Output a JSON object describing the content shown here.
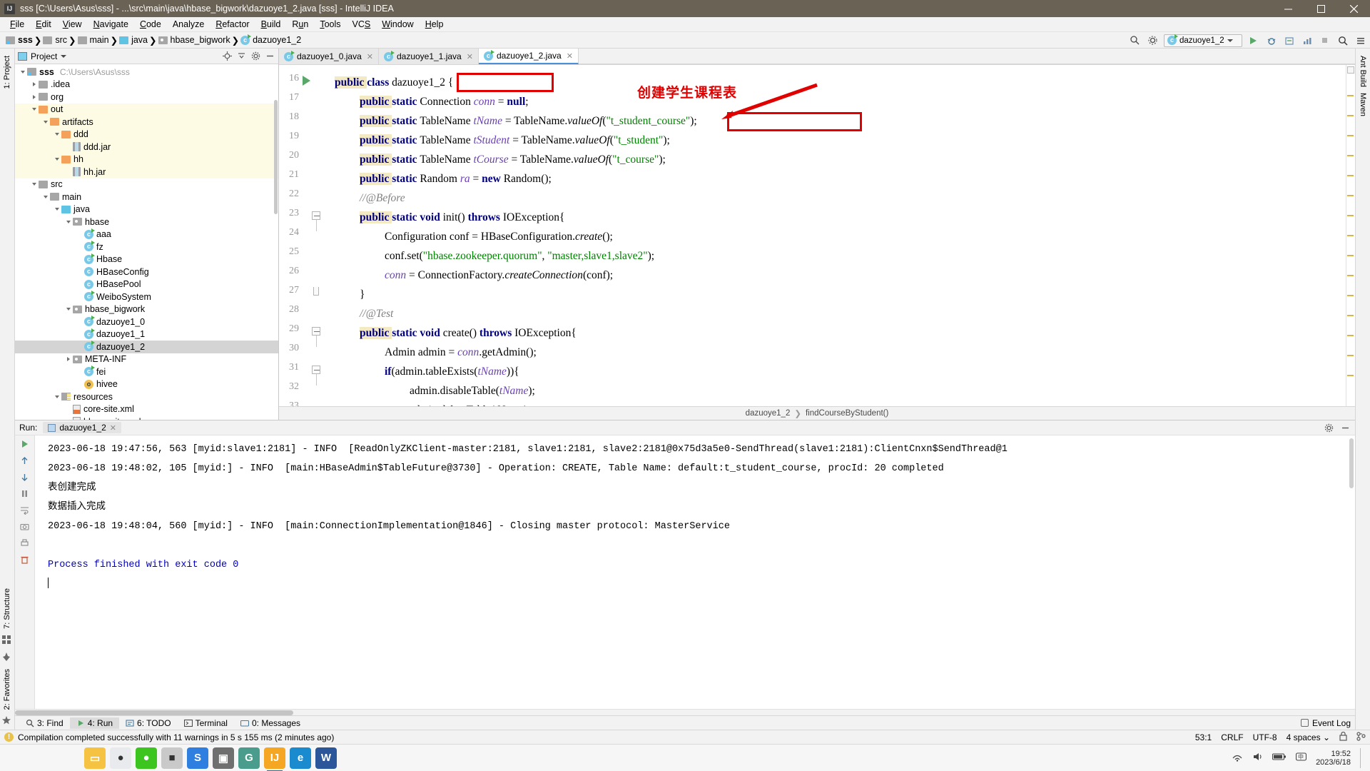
{
  "window": {
    "title": "sss [C:\\Users\\Asus\\sss] - ...\\src\\main\\java\\hbase_bigwork\\dazuoye1_2.java [sss] - IntelliJ IDEA",
    "app_icon": "IJ",
    "minimize": "minimize-icon",
    "maximize": "maximize-icon",
    "close": "close-icon"
  },
  "menu": [
    "File",
    "Edit",
    "View",
    "Navigate",
    "Code",
    "Analyze",
    "Refactor",
    "Build",
    "Run",
    "Tools",
    "VCS",
    "Window",
    "Help"
  ],
  "breadcrumb": [
    {
      "label": "sss",
      "icon": "module-folder-icon"
    },
    {
      "label": "src",
      "icon": "source-folder-icon"
    },
    {
      "label": "main",
      "icon": "folder-icon"
    },
    {
      "label": "java",
      "icon": "java-source-folder-icon"
    },
    {
      "label": "hbase_bigwork",
      "icon": "package-icon"
    },
    {
      "label": "dazuoye1_2",
      "icon": "java-class-icon"
    }
  ],
  "toolbar": {
    "run_config": "dazuoye1_2",
    "run_label": "run-button",
    "debug_label": "debug-button",
    "coverage_label": "coverage-button",
    "profile_label": "profile-button",
    "search_label": "search-button",
    "stop_label": "stop-button"
  },
  "left_strip": [
    "1: Project",
    "7: Structure",
    "2: Favorites"
  ],
  "right_strip": [
    "Ant Build",
    "Maven"
  ],
  "project_panel": {
    "title": "Project",
    "locate_icon": "locate-icon",
    "collapse_icon": "collapse-all-icon",
    "settings_icon": "gear-icon",
    "hide_icon": "hide-icon",
    "tree": [
      {
        "label": "sss",
        "path": "C:\\Users\\Asus\\sss",
        "depth": 0,
        "arrow": "open",
        "icon": "module-folder",
        "bold": true,
        "state": "normal"
      },
      {
        "label": ".idea",
        "depth": 1,
        "arrow": "closed",
        "icon": "folder",
        "state": "normal"
      },
      {
        "label": "org",
        "depth": 1,
        "arrow": "closed",
        "icon": "folder",
        "state": "normal"
      },
      {
        "label": "out",
        "depth": 1,
        "arrow": "open",
        "icon": "folder-orange",
        "state": "highlight"
      },
      {
        "label": "artifacts",
        "depth": 2,
        "arrow": "open",
        "icon": "folder-orange",
        "state": "highlight"
      },
      {
        "label": "ddd",
        "depth": 3,
        "arrow": "open",
        "icon": "folder-orange",
        "state": "highlight"
      },
      {
        "label": "ddd.jar",
        "depth": 4,
        "arrow": "none",
        "icon": "jar",
        "state": "highlight"
      },
      {
        "label": "hh",
        "depth": 3,
        "arrow": "open",
        "icon": "folder-orange",
        "state": "highlight"
      },
      {
        "label": "hh.jar",
        "depth": 4,
        "arrow": "none",
        "icon": "jar",
        "state": "highlight"
      },
      {
        "label": "src",
        "depth": 1,
        "arrow": "open",
        "icon": "folder",
        "state": "normal"
      },
      {
        "label": "main",
        "depth": 2,
        "arrow": "open",
        "icon": "folder",
        "state": "normal"
      },
      {
        "label": "java",
        "depth": 3,
        "arrow": "open",
        "icon": "folder-cyan",
        "state": "normal"
      },
      {
        "label": "hbase",
        "depth": 4,
        "arrow": "open",
        "icon": "package",
        "state": "normal"
      },
      {
        "label": "aaa",
        "depth": 5,
        "arrow": "none",
        "icon": "java-class-run",
        "state": "normal"
      },
      {
        "label": "fz",
        "depth": 5,
        "arrow": "none",
        "icon": "java-class-run",
        "state": "normal"
      },
      {
        "label": "Hbase",
        "depth": 5,
        "arrow": "none",
        "icon": "java-class-run",
        "state": "normal"
      },
      {
        "label": "HBaseConfig",
        "depth": 5,
        "arrow": "none",
        "icon": "java-class",
        "state": "normal"
      },
      {
        "label": "HBasePool",
        "depth": 5,
        "arrow": "none",
        "icon": "java-class",
        "state": "normal"
      },
      {
        "label": "WeiboSystem",
        "depth": 5,
        "arrow": "none",
        "icon": "java-class-run",
        "state": "normal"
      },
      {
        "label": "hbase_bigwork",
        "depth": 4,
        "arrow": "open",
        "icon": "package",
        "state": "normal"
      },
      {
        "label": "dazuoye1_0",
        "depth": 5,
        "arrow": "none",
        "icon": "java-class-run",
        "state": "normal"
      },
      {
        "label": "dazuoye1_1",
        "depth": 5,
        "arrow": "none",
        "icon": "java-class-run",
        "state": "normal"
      },
      {
        "label": "dazuoye1_2",
        "depth": 5,
        "arrow": "none",
        "icon": "java-class-run",
        "state": "selected"
      },
      {
        "label": "META-INF",
        "depth": 4,
        "arrow": "closed",
        "icon": "package",
        "state": "normal"
      },
      {
        "label": "fei",
        "depth": 5,
        "arrow": "none",
        "icon": "java-class-run",
        "state": "normal"
      },
      {
        "label": "hivee",
        "depth": 5,
        "arrow": "none",
        "icon": "object-class",
        "state": "normal"
      },
      {
        "label": "resources",
        "depth": 3,
        "arrow": "open",
        "icon": "resources-folder",
        "state": "normal"
      },
      {
        "label": "core-site.xml",
        "depth": 4,
        "arrow": "none",
        "icon": "xml-file",
        "state": "normal"
      },
      {
        "label": "hbase-site.xml",
        "depth": 4,
        "arrow": "none",
        "icon": "xml-file",
        "state": "normal"
      }
    ]
  },
  "editor": {
    "tabs": [
      {
        "label": "dazuoye1_0.java",
        "active": false
      },
      {
        "label": "dazuoye1_1.java",
        "active": false
      },
      {
        "label": "dazuoye1_2.java",
        "active": true
      }
    ],
    "first_line_number": 16,
    "lines": [
      {
        "n": 16,
        "runmark": true,
        "fold": "none",
        "indent": 0,
        "tokens": [
          {
            "t": "public ",
            "c": "kw hl-pub"
          },
          {
            "t": "class ",
            "c": "kw"
          },
          {
            "t": "dazuoye1_2 {",
            "c": "id"
          }
        ]
      },
      {
        "n": 17,
        "runmark": false,
        "fold": "none",
        "indent": 1,
        "tokens": [
          {
            "t": "public ",
            "c": "kw hl-pub"
          },
          {
            "t": "static ",
            "c": "kw"
          },
          {
            "t": "Connection ",
            "c": "id"
          },
          {
            "t": "conn",
            "c": "fieldv"
          },
          {
            "t": " = ",
            "c": "id"
          },
          {
            "t": "null",
            "c": "kw"
          },
          {
            "t": ";",
            "c": "id"
          }
        ]
      },
      {
        "n": 18,
        "runmark": false,
        "fold": "none",
        "indent": 1,
        "tokens": [
          {
            "t": "public ",
            "c": "kw hl-pub"
          },
          {
            "t": "static ",
            "c": "kw"
          },
          {
            "t": "TableName ",
            "c": "id"
          },
          {
            "t": "tName",
            "c": "fieldv"
          },
          {
            "t": " = TableName.",
            "c": "id"
          },
          {
            "t": "valueOf",
            "c": "mth"
          },
          {
            "t": "(",
            "c": "id"
          },
          {
            "t": "\"t_student_course\"",
            "c": "str"
          },
          {
            "t": ");",
            "c": "id"
          }
        ]
      },
      {
        "n": 19,
        "runmark": false,
        "fold": "none",
        "indent": 1,
        "tokens": [
          {
            "t": "public ",
            "c": "kw hl-pub"
          },
          {
            "t": "static ",
            "c": "kw"
          },
          {
            "t": "TableName ",
            "c": "id"
          },
          {
            "t": "tStudent",
            "c": "fieldv"
          },
          {
            "t": " = TableName.",
            "c": "id"
          },
          {
            "t": "valueOf",
            "c": "mth"
          },
          {
            "t": "(",
            "c": "id"
          },
          {
            "t": "\"t_student\"",
            "c": "str"
          },
          {
            "t": ");",
            "c": "id"
          }
        ]
      },
      {
        "n": 20,
        "runmark": false,
        "fold": "none",
        "indent": 1,
        "tokens": [
          {
            "t": "public ",
            "c": "kw hl-pub"
          },
          {
            "t": "static ",
            "c": "kw"
          },
          {
            "t": "TableName ",
            "c": "id"
          },
          {
            "t": "tCourse",
            "c": "fieldv"
          },
          {
            "t": " = TableName.",
            "c": "id"
          },
          {
            "t": "valueOf",
            "c": "mth"
          },
          {
            "t": "(",
            "c": "id"
          },
          {
            "t": "\"t_course\"",
            "c": "str"
          },
          {
            "t": ");",
            "c": "id"
          }
        ]
      },
      {
        "n": 21,
        "runmark": false,
        "fold": "none",
        "indent": 1,
        "tokens": [
          {
            "t": "public ",
            "c": "kw hl-pub"
          },
          {
            "t": "static ",
            "c": "kw"
          },
          {
            "t": "Random ",
            "c": "id"
          },
          {
            "t": "ra",
            "c": "fieldv"
          },
          {
            "t": " = ",
            "c": "id"
          },
          {
            "t": "new ",
            "c": "kw"
          },
          {
            "t": "Random();",
            "c": "id"
          }
        ]
      },
      {
        "n": 22,
        "runmark": false,
        "fold": "none",
        "indent": 1,
        "tokens": [
          {
            "t": "//@Before",
            "c": "cmt"
          }
        ]
      },
      {
        "n": 23,
        "runmark": false,
        "fold": "minus",
        "indent": 1,
        "tokens": [
          {
            "t": "public ",
            "c": "kw hl-pub"
          },
          {
            "t": "static ",
            "c": "kw"
          },
          {
            "t": "void ",
            "c": "kw"
          },
          {
            "t": "init() ",
            "c": "id"
          },
          {
            "t": "throws ",
            "c": "kw"
          },
          {
            "t": "IOException{",
            "c": "id"
          }
        ]
      },
      {
        "n": 24,
        "runmark": false,
        "fold": "none",
        "indent": 2,
        "tokens": [
          {
            "t": "Configuration conf = HBaseConfiguration.",
            "c": "id"
          },
          {
            "t": "create",
            "c": "mth"
          },
          {
            "t": "();",
            "c": "id"
          }
        ]
      },
      {
        "n": 25,
        "runmark": false,
        "fold": "none",
        "indent": 2,
        "tokens": [
          {
            "t": "conf.set(",
            "c": "id"
          },
          {
            "t": "\"hbase.zookeeper.quorum\"",
            "c": "str"
          },
          {
            "t": ", ",
            "c": "id"
          },
          {
            "t": "\"master,slave1,slave2\"",
            "c": "str"
          },
          {
            "t": ");",
            "c": "id"
          }
        ]
      },
      {
        "n": 26,
        "runmark": false,
        "fold": "none",
        "indent": 2,
        "tokens": [
          {
            "t": "conn",
            "c": "fieldv"
          },
          {
            "t": " = ConnectionFactory.",
            "c": "id"
          },
          {
            "t": "createConnection",
            "c": "mth"
          },
          {
            "t": "(conf);",
            "c": "id"
          }
        ]
      },
      {
        "n": 27,
        "runmark": false,
        "fold": "end",
        "indent": 1,
        "tokens": [
          {
            "t": "}",
            "c": "id"
          }
        ]
      },
      {
        "n": 28,
        "runmark": false,
        "fold": "none",
        "indent": 1,
        "tokens": [
          {
            "t": "//@Test",
            "c": "cmt"
          }
        ]
      },
      {
        "n": 29,
        "runmark": false,
        "fold": "minus",
        "indent": 1,
        "tokens": [
          {
            "t": "public ",
            "c": "kw hl-pub"
          },
          {
            "t": "static ",
            "c": "kw"
          },
          {
            "t": "void ",
            "c": "kw"
          },
          {
            "t": "create() ",
            "c": "id"
          },
          {
            "t": "throws ",
            "c": "kw"
          },
          {
            "t": "IOException{",
            "c": "id"
          }
        ]
      },
      {
        "n": 30,
        "runmark": false,
        "fold": "none",
        "indent": 2,
        "tokens": [
          {
            "t": "Admin admin = ",
            "c": "id"
          },
          {
            "t": "conn",
            "c": "fieldv"
          },
          {
            "t": ".getAdmin();",
            "c": "id"
          }
        ]
      },
      {
        "n": 31,
        "runmark": false,
        "fold": "minus",
        "indent": 2,
        "tokens": [
          {
            "t": "if",
            "c": "kw"
          },
          {
            "t": "(admin.tableExists(",
            "c": "id"
          },
          {
            "t": "tName",
            "c": "fieldv"
          },
          {
            "t": ")){",
            "c": "id"
          }
        ]
      },
      {
        "n": 32,
        "runmark": false,
        "fold": "none",
        "indent": 3,
        "tokens": [
          {
            "t": "admin.disableTable(",
            "c": "id"
          },
          {
            "t": "tName",
            "c": "fieldv"
          },
          {
            "t": ");",
            "c": "id"
          }
        ]
      },
      {
        "n": 33,
        "runmark": false,
        "fold": "none",
        "indent": 3,
        "tokens": [
          {
            "t": "admin.deleteTable(tName);",
            "c": "id"
          }
        ]
      }
    ],
    "breadcrumb_path": [
      "dazuoye1_2",
      "findCourseByStudent()"
    ]
  },
  "annotations": {
    "comment_text": "创建学生课程表",
    "box_class_name": "dazuoye1_2 {",
    "box_table_name": "\"t_student_course\""
  },
  "run_panel": {
    "label": "Run:",
    "tab": "dazuoye1_2",
    "settings_icon": "gear-icon",
    "hide_icon": "hide-icon",
    "side_buttons": [
      "rerun-icon",
      "scroll-up-icon",
      "scroll-down-icon",
      "soft-wrap-icon",
      "pause-icon",
      "camera-icon",
      "print-icon",
      "trash-icon"
    ],
    "console_lines": [
      {
        "text": "2023-06-18 19:47:56, 563 [myid:slave1:2181] - INFO  [ReadOnlyZKClient-master:2181, slave1:2181, slave2:2181@0x75d3a5e0-SendThread(slave1:2181):ClientCnxn$SendThread@1",
        "style": "plain"
      },
      {
        "text": "2023-06-18 19:48:02, 105 [myid:] - INFO  [main:HBaseAdmin$TableFuture@3730] - Operation: CREATE, Table Name: default:t_student_course, procId: 20 completed",
        "style": "plain"
      },
      {
        "text": "表创建完成",
        "style": "plain"
      },
      {
        "text": "数据插入完成",
        "style": "plain"
      },
      {
        "text": "2023-06-18 19:48:04, 560 [myid:] - INFO  [main:ConnectionImplementation@1846] - Closing master protocol: MasterService",
        "style": "plain"
      },
      {
        "text": "",
        "style": "plain"
      },
      {
        "text": "Process finished with exit code 0",
        "style": "blue"
      }
    ]
  },
  "bottom_tabs": [
    {
      "label": "3: Find",
      "icon": "search-icon",
      "active": false
    },
    {
      "label": "4: Run",
      "icon": "run-icon",
      "active": true
    },
    {
      "label": "6: TODO",
      "icon": "todo-icon",
      "active": false
    },
    {
      "label": "Terminal",
      "icon": "terminal-icon",
      "active": false
    },
    {
      "label": "0: Messages",
      "icon": "messages-icon",
      "active": false
    }
  ],
  "event_log": {
    "label": "Event Log",
    "icon": "event-log-icon"
  },
  "status_bar": {
    "message": "Compilation completed successfully with 11 warnings in 5 s 155 ms (2 minutes ago)",
    "icon": "warning-icon",
    "caret_position": "53:1",
    "line_separator": "CRLF",
    "encoding": "UTF-8",
    "indent": "4 spaces",
    "lock_icon": "lock-icon",
    "branch_icon": "branch-icon"
  },
  "taskbar": {
    "items": [
      {
        "name": "file-explorer",
        "glyph": "▭",
        "color": "#f5c242"
      },
      {
        "name": "chrome",
        "glyph": "●",
        "color": "#e8eaed"
      },
      {
        "name": "wechat",
        "glyph": "●",
        "color": "#3cc51f"
      },
      {
        "name": "notes-app",
        "glyph": "■",
        "color": "#c9c9c9"
      },
      {
        "name": "sogou-input",
        "glyph": "S",
        "color": "#2f7fe0"
      },
      {
        "name": "camtasia",
        "glyph": "▣",
        "color": "#6f6f6f"
      },
      {
        "name": "groovy-app",
        "glyph": "G",
        "color": "#4a9c8c"
      },
      {
        "name": "intellij-idea",
        "glyph": "IJ",
        "color": "#f5a623"
      },
      {
        "name": "edge-browser",
        "glyph": "e",
        "color": "#1b8bd0"
      },
      {
        "name": "word",
        "glyph": "W",
        "color": "#2b579a"
      }
    ],
    "tray": [
      "network-icon",
      "volume-icon",
      "battery-icon",
      "input-method-icon",
      "show-desktop-icon"
    ],
    "time": "19:52",
    "date": "2023/6/18"
  }
}
